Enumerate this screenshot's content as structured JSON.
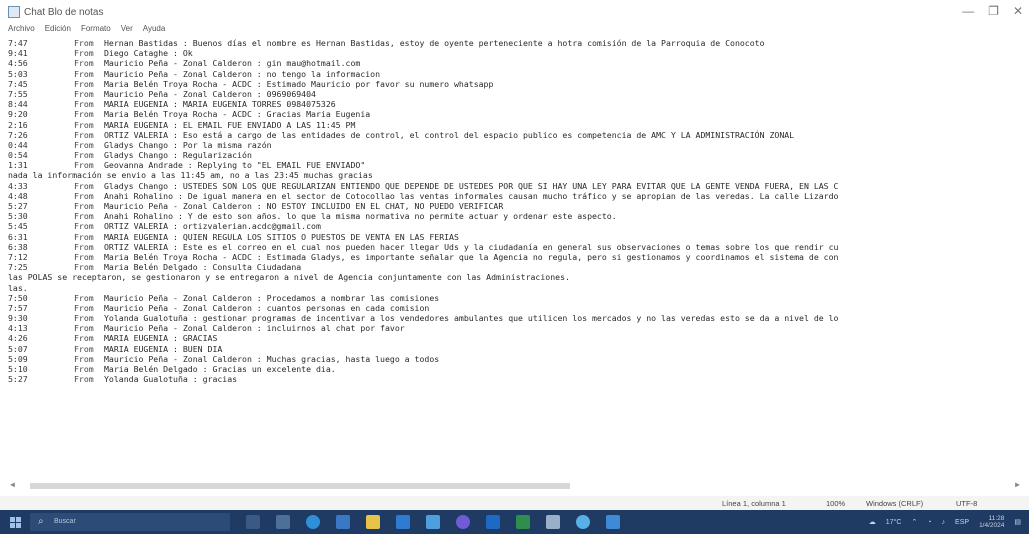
{
  "window": {
    "title": "Chat Blo de notas",
    "controls": {
      "minimize": "—",
      "maximize": "❐",
      "close": "✕"
    }
  },
  "menu": [
    "Archivo",
    "Edición",
    "Formato",
    "Ver",
    "Ayuda"
  ],
  "lines": [
    {
      "time": "7:47",
      "from": "From",
      "text": "Hernan Bastidas : Buenos días el nombre es Hernan Bastidas, estoy de oyente perteneciente a hotra comisión de la Parroquia de Conocoto"
    },
    {
      "time": "9:41",
      "from": "From",
      "text": "Diego Cataghe : Ok"
    },
    {
      "time": "4:56",
      "from": "From",
      "text": "Mauricio Peña - Zonal Calderon : gin mau@hotmail.com"
    },
    {
      "time": "5:03",
      "from": "From",
      "text": "Mauricio Peña - Zonal Calderon : no tengo la informacion"
    },
    {
      "time": "7:45",
      "from": "From",
      "text": "Maria Belén Troya Rocha - ACDC : Estimado Mauricio por favor su numero whatsapp"
    },
    {
      "time": "7:55",
      "from": "From",
      "text": "Mauricio Peña - Zonal Calderon : 0969069404"
    },
    {
      "time": "8:44",
      "from": "From",
      "text": "MARIA EUGENIA : MARIA EUGENIA TORRES 0984075326"
    },
    {
      "time": "9:20",
      "from": "From",
      "text": "Maria Belén Troya Rocha - ACDC : Gracias Maria Eugenia"
    },
    {
      "time": "2:16",
      "from": "From",
      "text": "MARIA EUGENIA : EL EMAIL FUE ENVIADO A LAS 11:45 PM"
    },
    {
      "time": "7:26",
      "from": "From",
      "text": "ORTIZ VALERIA : Eso está a cargo de las entidades de control, el control del espacio publico es competencia de AMC Y LA ADMINISTRACIÓN ZONAL"
    },
    {
      "time": "0:44",
      "from": "From",
      "text": "Gladys Chango : Por la misma razón"
    },
    {
      "time": "0:54",
      "from": "From",
      "text": "Gladys Chango : Regularización"
    },
    {
      "time": "1:31",
      "from": "From",
      "text": "Geovanna Andrade : Replying to \"EL EMAIL FUE ENVIADO\""
    },
    {
      "cont": true,
      "text": "nada la información se envio a las 11:45 am, no a las 23:45 muchas gracias"
    },
    {
      "time": "4:33",
      "from": "From",
      "text": "Gladys Chango : USTEDES SON LOS QUE REGULARIZAN ENTIENDO QUE DEPENDE DE USTEDES POR QUE SI HAY UNA LEY PARA EVITAR QUE LA GENTE VENDA FUERA, EN LAS C"
    },
    {
      "time": "4:48",
      "from": "From",
      "text": "Anahi Rohalino : De igual manera en el sector de Cotocollao las ventas informales causan mucho tráfico y se apropian de las veredas. La calle Lizardo"
    },
    {
      "time": "5:27",
      "from": "From",
      "text": "Mauricio Peña - Zonal Calderon : NO ESTOY INCLUIDO EN EL CHAT, NO PUEDO VERIFICAR"
    },
    {
      "time": "5:30",
      "from": "From",
      "text": "Anahi Rohalino : Y de esto son años. lo que la misma normativa no permite actuar y ordenar este aspecto."
    },
    {
      "time": "5:45",
      "from": "From",
      "text": "ORTIZ VALERIA : ortizvalerian.acdc@gmail.com"
    },
    {
      "time": "6:31",
      "from": "From",
      "text": "MARIA EUGENIA : QUIEN REGULA LOS SITIOS O PUESTOS DE VENTA EN LAS FERIAS"
    },
    {
      "time": "6:38",
      "from": "From",
      "text": "ORTIZ VALERIA : Este es el correo en el cual nos pueden hacer llegar Uds y la ciudadanía en general sus observaciones o temas sobre los que rendir cu"
    },
    {
      "time": "7:12",
      "from": "From",
      "text": "Maria Belén Troya Rocha - ACDC : Estimada Gladys, es importante señalar que la Agencia no regula, pero si gestionamos y coordinamos el sistema de con"
    },
    {
      "time": "7:25",
      "from": "From",
      "text": "Maria Belén Delgado : Consulta Ciudadana"
    },
    {
      "cont": true,
      "text": "las POLAS se receptaron, se gestionaron y se entregaron a nivel de Agencia conjuntamente con las Administraciones."
    },
    {
      "cont": true,
      "text": "las."
    },
    {
      "time": "7:50",
      "from": "From",
      "text": "Mauricio Peña - Zonal Calderon : Procedamos a nombrar las comisiones"
    },
    {
      "time": "7:57",
      "from": "From",
      "text": "Mauricio Peña - Zonal Calderon : cuantos personas en cada comision"
    },
    {
      "time": "9:30",
      "from": "From",
      "text": "Yolanda Gualotuña : gestionar programas de incentivar a los vendedores ambulantes que utilicen los mercados y no las veredas esto se da a nivel de lo"
    },
    {
      "time": "4:13",
      "from": "From",
      "text": "Mauricio Peña - Zonal Calderon : incluirnos al chat por favor"
    },
    {
      "time": "4:26",
      "from": "From",
      "text": "MARIA EUGENIA : GRACIAS"
    },
    {
      "time": "5:07",
      "from": "From",
      "text": "MARIA EUGENIA : BUEN DIA"
    },
    {
      "time": "5:09",
      "from": "From",
      "text": "Mauricio Peña - Zonal Calderon : Muchas gracias, hasta luego a todos"
    },
    {
      "time": "5:10",
      "from": "From",
      "text": "Maria Belén Delgado : Gracias un excelente dia."
    },
    {
      "time": "5:27",
      "from": "From",
      "text": "Yolanda Gualotuña : gracias"
    }
  ],
  "statusbar": {
    "position": "Línea 1, columna 1",
    "zoom": "100%",
    "line_ending": "Windows (CRLF)",
    "encoding": "UTF-8"
  },
  "taskbar": {
    "search_placeholder": "Buscar",
    "weather": "17°C",
    "language": "ESP",
    "time": "11:28",
    "date": "1/4/2024"
  },
  "colors": {
    "taskbar": "#1f3b63",
    "editor_bg": "#ffffff"
  }
}
